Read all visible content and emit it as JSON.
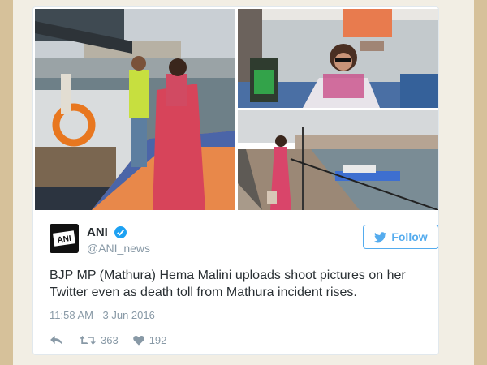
{
  "colors": {
    "frame": "#d6c19a",
    "background": "#f2eee4",
    "accent": "#55acee",
    "text": "#292f33",
    "muted": "#8899a6",
    "verified": "#1da1f2"
  },
  "tweet": {
    "display_name": "ANI",
    "handle": "@ANI_news",
    "follow_label": "Follow",
    "text": "BJP MP (Mathura) Hema Malini uploads shoot pictures on her Twitter even as death toll from Mathura incident rises.",
    "timestamp": "11:58 AM - 3 Jun 2016",
    "retweet_count": "363",
    "like_count": "192",
    "avatar_text": "ANI",
    "icons": {
      "verified": "verified-badge-icon",
      "follow": "twitter-bird-icon",
      "reply": "reply-icon",
      "retweet": "retweet-icon",
      "like": "heart-icon"
    }
  }
}
